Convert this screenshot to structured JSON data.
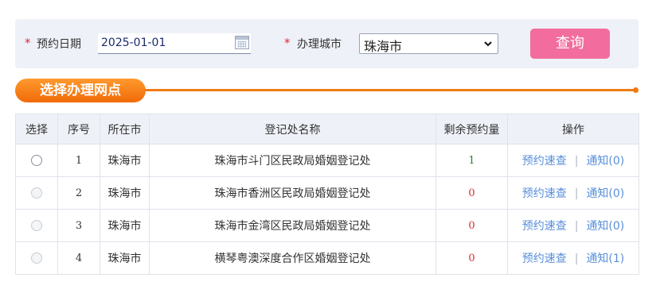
{
  "filter": {
    "date_label": "预约日期",
    "date_value": "2025-01-01",
    "city_label": "办理城市",
    "city_value": "珠海市",
    "search_label": "查询",
    "required_mark": "*"
  },
  "section": {
    "title": "选择办理网点"
  },
  "table": {
    "headers": [
      "选择",
      "序号",
      "所在市",
      "登记处名称",
      "剩余预约量",
      "操作"
    ],
    "rows": [
      {
        "seq": "1",
        "city": "珠海市",
        "name": "珠海市斗门区民政局婚姻登记处",
        "remaining": "1",
        "action1": "预约速查",
        "action2": "通知(0)",
        "selectable": true
      },
      {
        "seq": "2",
        "city": "珠海市",
        "name": "珠海市香洲区民政局婚姻登记处",
        "remaining": "0",
        "action1": "预约速查",
        "action2": "通知(0)",
        "selectable": false
      },
      {
        "seq": "3",
        "city": "珠海市",
        "name": "珠海市金湾区民政局婚姻登记处",
        "remaining": "0",
        "action1": "预约速查",
        "action2": "通知(0)",
        "selectable": false
      },
      {
        "seq": "4",
        "city": "珠海市",
        "name": "横琴粤澳深度合作区婚姻登记处",
        "remaining": "0",
        "action1": "预约速查",
        "action2": "通知(1)",
        "selectable": false
      }
    ],
    "separator": "|"
  },
  "colors": {
    "accent_orange": "#f07b12",
    "search_pink": "#f26d9d",
    "link_blue": "#5a8fd8",
    "remaining_ok": "#2e7d32",
    "remaining_zero": "#d32f2f",
    "required_red": "#e0293b"
  },
  "icons": [
    "calendar-icon",
    "chevron-down-icon",
    "radio-button"
  ]
}
